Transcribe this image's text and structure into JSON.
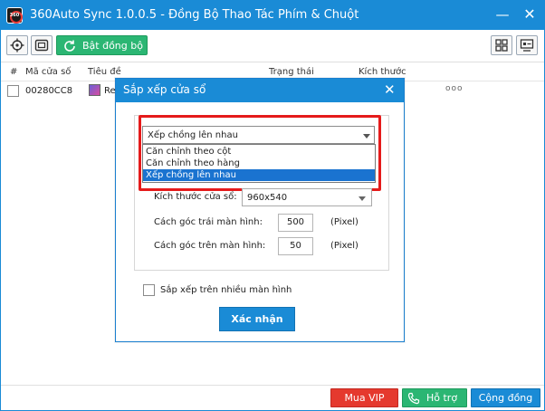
{
  "app": {
    "title": "360Auto Sync 1.0.0.5 - Đồng Bộ Thao Tác Phím & Chuột",
    "logo_text": "360",
    "minimize_glyph": "—",
    "close_glyph": "✕"
  },
  "toolbar": {
    "sync_label": "Bật đồng bộ"
  },
  "table": {
    "headers": {
      "index": "#",
      "window_id": "Mã cửa số",
      "title": "Tiêu đề",
      "status": "Trạng thái",
      "size": "Kích thước"
    },
    "rows": [
      {
        "window_id": "00280CC8",
        "title": "Re",
        "more": "ooo"
      }
    ]
  },
  "dialog": {
    "title": "Sắp xếp cửa sổ",
    "close_glyph": "✕",
    "arrange_select": {
      "selected": "Xếp chồng lên nhau",
      "options": [
        "Căn chỉnh theo cột",
        "Căn chỉnh theo hàng",
        "Xếp chồng lên nhau"
      ]
    },
    "window_size_label": "Kích thước cửa sổ:",
    "window_size_value": "960x540",
    "left_offset_label": "Cách góc trái màn hình:",
    "left_offset_value": "500",
    "top_offset_label": "Cách góc trên màn hình:",
    "top_offset_value": "50",
    "unit": "(Pixel)",
    "multi_screen_label": "Sắp xếp trên nhiều màn hình",
    "confirm_label": "Xác nhận"
  },
  "bottombar": {
    "vip_label": "Mua VIP",
    "support_label": "Hỗ trợ",
    "community_label": "Cộng đồng"
  },
  "colors": {
    "primary": "#1a8bd6",
    "green": "#2bb673",
    "red": "#e5392e",
    "highlight": "#e51b1b"
  }
}
